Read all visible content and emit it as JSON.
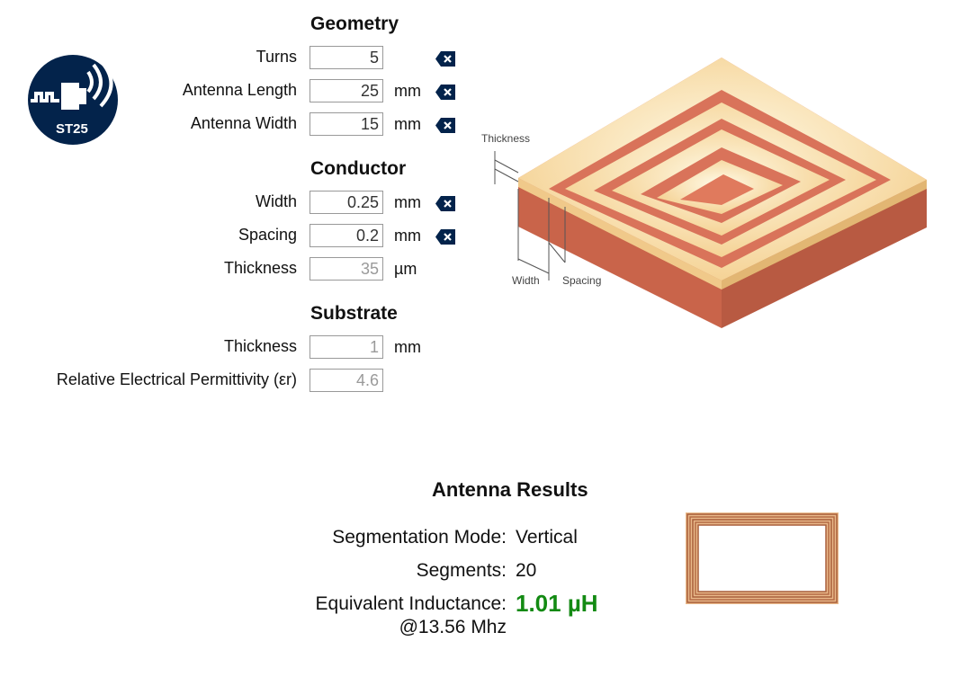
{
  "logo": {
    "text": "ST25",
    "icon": "nfc-antenna-logo-icon"
  },
  "geometry": {
    "title": "Geometry",
    "fields": [
      {
        "label": "Turns",
        "value": "5",
        "unit": ""
      },
      {
        "label": "Antenna Length",
        "value": "25",
        "unit": "mm"
      },
      {
        "label": "Antenna Width",
        "value": "15",
        "unit": "mm"
      }
    ]
  },
  "conductor": {
    "title": "Conductor",
    "fields": [
      {
        "label": "Width",
        "value": "0.25",
        "unit": "mm"
      },
      {
        "label": "Spacing",
        "value": "0.2",
        "unit": "mm"
      },
      {
        "label": "Thickness",
        "value": "35",
        "unit": "µm"
      }
    ]
  },
  "substrate": {
    "title": "Substrate",
    "fields": [
      {
        "label": "Thickness",
        "value": "1",
        "unit": "mm"
      },
      {
        "label": "Relative Electrical Permittivity (εr)",
        "value": "4.6",
        "unit": ""
      }
    ]
  },
  "diagram": {
    "thickness": "Thickness",
    "width": "Width",
    "spacing": "Spacing"
  },
  "results": {
    "title": "Antenna Results",
    "segmentation_label": "Segmentation Mode:",
    "segmentation_value": "Vertical",
    "segments_label": "Segments:",
    "segments_value": "20",
    "inductance_label": "Equivalent Inductance:",
    "inductance_freq": "@13.56 Mhz",
    "inductance_value": "1.01 µH"
  },
  "colors": {
    "brand": "#03234b",
    "result": "#138a13",
    "copper": "#c96a4f",
    "gold": "#f5d7a0"
  }
}
